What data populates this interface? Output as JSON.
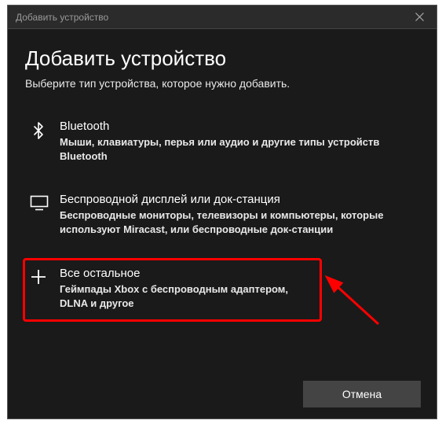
{
  "titlebar": {
    "title": "Добавить устройство"
  },
  "heading": "Добавить устройство",
  "subtitle": "Выберите тип устройства, которое нужно добавить.",
  "options": {
    "bluetooth": {
      "title": "Bluetooth",
      "desc": "Мыши, клавиатуры, перья или аудио и другие типы устройств Bluetooth"
    },
    "wireless": {
      "title": "Беспроводной дисплей или док-станция",
      "desc": "Беспроводные мониторы, телевизоры и компьютеры, которые используют Miracast, или беспроводные док-станции"
    },
    "other": {
      "title": "Все остальное",
      "desc": "Геймпады Xbox с беспроводным адаптером, DLNA и другое"
    }
  },
  "footer": {
    "cancel": "Отмена"
  }
}
